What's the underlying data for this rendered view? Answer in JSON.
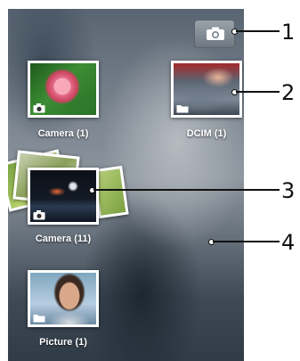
{
  "camera_button": {
    "icon": "camera-icon"
  },
  "albums": [
    {
      "label": "Camera  (1)",
      "badge": "camera-icon"
    },
    {
      "label": "DCIM  (1)",
      "badge": "folder-icon"
    },
    {
      "label": "Camera  (11)",
      "badge": "camera-icon"
    },
    {
      "label": "Picture  (1)",
      "badge": "folder-icon"
    }
  ],
  "callouts": [
    "1",
    "2",
    "3",
    "4"
  ]
}
